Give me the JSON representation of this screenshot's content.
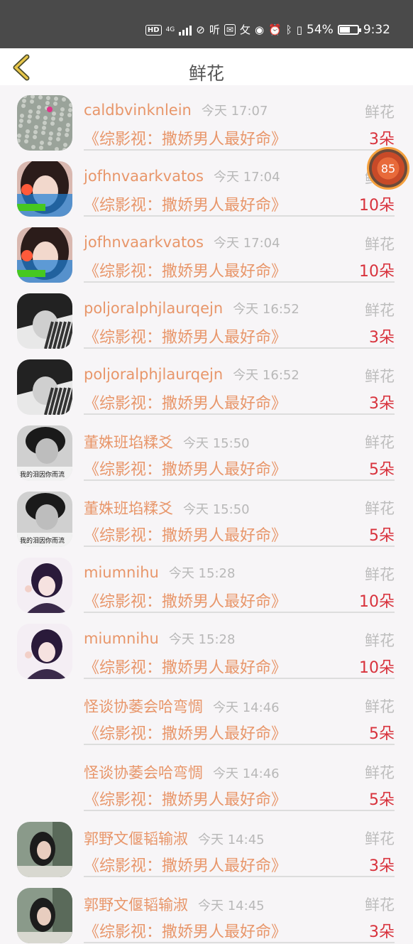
{
  "statusbar": {
    "hd": "HD",
    "net": "4G",
    "battery_pct": "54%",
    "battery_level": 0.54,
    "time": "9:32",
    "icons": [
      "hd-icon",
      "signal-icon",
      "wifi-off-icon",
      "ting-icon",
      "app-icon",
      "handwriting-icon",
      "eye-icon",
      "alarm-icon",
      "bluetooth-icon",
      "vibrate-icon",
      "battery-icon"
    ]
  },
  "header": {
    "title": "鲜花",
    "back_icon": "chevron-left-icon"
  },
  "floater": {
    "label": "85"
  },
  "gift_label": "鲜花",
  "rows": [
    {
      "name": "caldbvinknlein",
      "time": "今天 17:07",
      "book": "《综影视：撒娇男人最好命》",
      "count": "3朵",
      "avatar": "cactus"
    },
    {
      "name": "jofhnvaarkvatos",
      "time": "今天 17:04",
      "book": "《综影视：撒娇男人最好命》",
      "count": "10朵",
      "avatar": "girl"
    },
    {
      "name": "jofhnvaarkvatos",
      "time": "今天 17:04",
      "book": "《综影视：撒娇男人最好命》",
      "count": "10朵",
      "avatar": "girl"
    },
    {
      "name": "poljoralphjlaurqejn",
      "time": "今天 16:52",
      "book": "《综影视：撒娇男人最好命》",
      "count": "3朵",
      "avatar": "bw"
    },
    {
      "name": "poljoralphjlaurqejn",
      "time": "今天 16:52",
      "book": "《综影视：撒娇男人最好命》",
      "count": "3朵",
      "avatar": "bw"
    },
    {
      "name": "董姝班埳糅爻",
      "time": "今天 15:50",
      "book": "《综影视：撒娇男人最好命》",
      "count": "5朵",
      "avatar": "boy"
    },
    {
      "name": "董姝班埳糅爻",
      "time": "今天 15:50",
      "book": "《综影视：撒娇男人最好命》",
      "count": "5朵",
      "avatar": "boy"
    },
    {
      "name": "miumnihu",
      "time": "今天 15:28",
      "book": "《综影视：撒娇男人最好命》",
      "count": "10朵",
      "avatar": "anime"
    },
    {
      "name": "miumnihu",
      "time": "今天 15:28",
      "book": "《综影视：撒娇男人最好命》",
      "count": "10朵",
      "avatar": "anime"
    },
    {
      "name": "怪谈协萎会哈弯惆",
      "time": "今天 14:46",
      "book": "《综影视：撒娇男人最好命》",
      "count": "5朵",
      "avatar": "none"
    },
    {
      "name": "怪谈协萎会哈弯惆",
      "time": "今天 14:46",
      "book": "《综影视：撒娇男人最好命》",
      "count": "5朵",
      "avatar": "none"
    },
    {
      "name": "郭野文偃韬输淑",
      "time": "今天 14:45",
      "book": "《综影视：撒娇男人最好命》",
      "count": "3朵",
      "avatar": "woman"
    },
    {
      "name": "郭野文偃韬输淑",
      "time": "今天 14:45",
      "book": "《综影视：撒娇男人最好命》",
      "count": "3朵",
      "avatar": "woman"
    }
  ]
}
